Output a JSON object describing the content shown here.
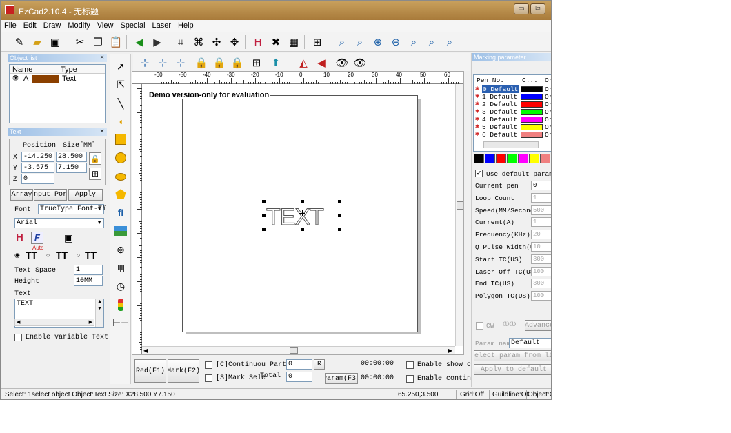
{
  "window": {
    "title": "EzCad2.10.4 - 无标题",
    "min_label": "▭",
    "max_label": "⧉"
  },
  "menu": [
    "File",
    "Edit",
    "Draw",
    "Modify",
    "View",
    "Special",
    "Laser",
    "Help"
  ],
  "object_list": {
    "title": "Object list",
    "col_name": "Name",
    "col_type": "Type",
    "row_name": "A",
    "row_type": "Text",
    "row_color": "#8b4000"
  },
  "text_panel": {
    "title": "Text",
    "position_label": "Position",
    "size_label": "Size[MM]",
    "x_label": "X",
    "y_label": "Y",
    "z_label": "Z",
    "x_pos": "-14.250",
    "x_size": "28.500",
    "y_pos": "-3.575",
    "y_size": "7.150",
    "z_val": "0",
    "array_btn": "Array",
    "input_port_btn": "nput Por",
    "apply_btn": "Apply",
    "font_label": "Font",
    "font_type": "TrueType Font-Tï",
    "font_name": "Arial",
    "auto_label": "Auto",
    "text_space_label": "Text Space",
    "text_space_val": "1",
    "height_label": "Height",
    "height_val": "10MM",
    "text_label": "Text",
    "text_value": "TEXT",
    "variable_text_label": "Enable variable Text"
  },
  "canvas": {
    "watermark": "Demo version-only for evaluation",
    "object_text": "TEXT",
    "ruler_labels": [
      "-60",
      "-50",
      "-40",
      "-30",
      "-20",
      "-10",
      "0",
      "10",
      "20",
      "30",
      "40",
      "50",
      "60"
    ]
  },
  "bottom_controls": {
    "red_btn": "Red(F1)",
    "mark_btn": "Mark(F2)",
    "continuous_label": "[C]Continuou Part",
    "part_val": "0",
    "r_btn": "R",
    "time1": "00:00:00",
    "enable_show_label": "Enable show c",
    "mark_select_label": "[S]Mark Sele",
    "total_label": "Total",
    "total_val": "0",
    "param_btn": "Param(F3)",
    "time2": "00:00:00",
    "enable_contin_label": "Enable contin"
  },
  "marking": {
    "title": "Marking parameter",
    "col_pen": "Pen No.",
    "col_color": "C...",
    "col_on": "Or",
    "pens": [
      {
        "label": "0 Default",
        "color": "#000000",
        "on": "Or"
      },
      {
        "label": "1 Default",
        "color": "#0000ff",
        "on": "Or"
      },
      {
        "label": "2 Default",
        "color": "#ff0000",
        "on": "Or"
      },
      {
        "label": "3 Default",
        "color": "#00ff00",
        "on": "Or"
      },
      {
        "label": "4 Default",
        "color": "#ff00ff",
        "on": "Or"
      },
      {
        "label": "5 Default",
        "color": "#ffff00",
        "on": "Or"
      },
      {
        "label": "6 Default",
        "color": "#f08080",
        "on": "Or"
      }
    ],
    "palette": [
      "#000000",
      "#0000ff",
      "#ff0000",
      "#00ff00",
      "#ff00ff",
      "#ffff00",
      "#f08080"
    ],
    "use_default": "Use default param",
    "params": [
      {
        "label": "Current pen",
        "value": "0"
      },
      {
        "label": "Loop Count",
        "value": "1"
      },
      {
        "label": "Speed(MM/Second",
        "value": "500"
      },
      {
        "label": "Current(A)",
        "value": "1"
      },
      {
        "label": "Frequency(KHz)",
        "value": "20"
      },
      {
        "label": "Q Pulse Width(U",
        "value": "10"
      },
      {
        "label": "Start TC(US)",
        "value": "300"
      },
      {
        "label": "Laser Off TC(US",
        "value": "100"
      },
      {
        "label": "End TC(US)",
        "value": "300"
      },
      {
        "label": "Polygon TC(US)",
        "value": "100"
      }
    ],
    "cw_label": "CW",
    "advance_btn": "Advance",
    "param_name_label": "Param name",
    "param_name_val": "Default",
    "select_lib_btn": "Select param from lib",
    "apply_default_btn": "Apply to default"
  },
  "status": {
    "select": "Select: 1select object Object:Text Size: X28.500 Y7.150",
    "coords": "65.250,3.500",
    "grid": "Grid:Off",
    "guideline": "Guildline:Of",
    "object": "Object:C"
  }
}
